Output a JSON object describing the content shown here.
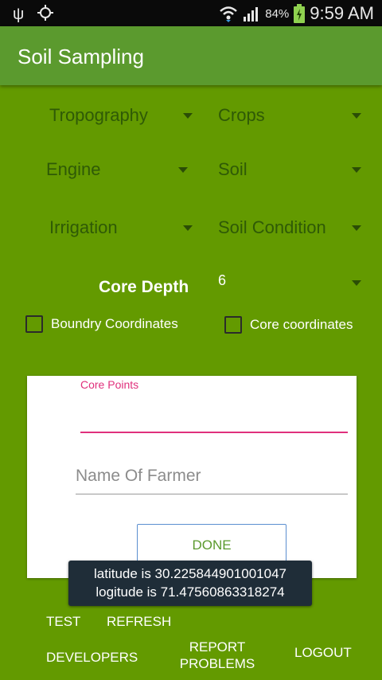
{
  "status_bar": {
    "battery_percent": "84%",
    "time": "9:59 AM",
    "icons": [
      "usb-icon",
      "gps-icon",
      "wifi-icon",
      "signal-icon",
      "battery-charging-icon"
    ]
  },
  "app_bar": {
    "title": "Soil Sampling"
  },
  "spinners": {
    "topography": "Tropography",
    "crops": "Crops",
    "engine": "Engine",
    "soil": "Soil",
    "irrigation": "Irrigation",
    "soil_condition": "Soil Condition",
    "core_depth_value": "6"
  },
  "core_depth_label": "Core Depth",
  "checkboxes": {
    "boundary": {
      "label": "Boundry Coordinates",
      "checked": false
    },
    "core": {
      "label": "Core coordinates",
      "checked": false
    }
  },
  "form": {
    "core_points_label": "Core Points",
    "core_points_value": "",
    "farmer_name_placeholder": "Name Of Farmer",
    "done_label": "DONE"
  },
  "toast": {
    "latitude": "latitude is 30.225844901001047",
    "longitude": "logitude is 71.47560863318274"
  },
  "bottom_buttons": {
    "test": "TEST",
    "refresh": "REFRESH",
    "developers": "DEVELOPERS",
    "report_line1": "REPORT",
    "report_line2": "PROBLEMS",
    "logout": "LOGOUT"
  },
  "colors": {
    "background": "#639a00",
    "app_bar": "#5b9a2e",
    "accent": "#e0307c",
    "button_text": "#5b9a2e"
  }
}
